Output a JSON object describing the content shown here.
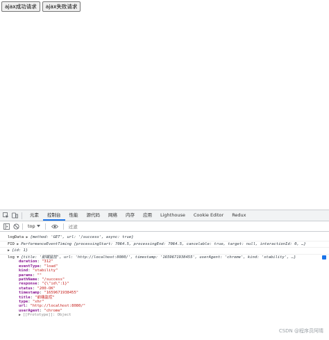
{
  "page": {
    "buttons": [
      "ajax成功请求",
      "ajax失败请求"
    ]
  },
  "devtools": {
    "tabs": [
      "元素",
      "控制台",
      "性能",
      "源代码",
      "网络",
      "内存",
      "应用",
      "Lighthouse",
      "Cookie Editor",
      "Redux"
    ],
    "active_tab": "控制台",
    "toolbar": {
      "context": "top",
      "filter_placeholder": "过滤"
    }
  },
  "console": {
    "line1": {
      "label": "logData",
      "text": "{method: 'GET', url: '/success', async: true}"
    },
    "line2": {
      "label": "FID",
      "type": "PerformanceEventTiming",
      "text": "{processingStart: 7064.5, processingEnd: 7064.5, cancelable: true, target: null, interactionId: 0, …}"
    },
    "line3": {
      "text": "{id: 1}"
    },
    "line4": {
      "label": "log",
      "text": "{title: '前端监控', url: 'http://localhost:8080/', timestamp: '1659671938455', userAgent: 'chrome', kind: 'stability', …}",
      "props": [
        {
          "key": "duration",
          "value": "\"312\""
        },
        {
          "key": "eventType",
          "value": "\"load\""
        },
        {
          "key": "kind",
          "value": "\"stability\""
        },
        {
          "key": "params",
          "value": "\"\""
        },
        {
          "key": "pathName",
          "value": "\"/success\""
        },
        {
          "key": "response",
          "value": "\"{\\\"id\\\":1}\""
        },
        {
          "key": "status",
          "value": "\"200-OK\""
        },
        {
          "key": "timestamp",
          "value": "\"1659671938455\""
        },
        {
          "key": "title",
          "value": "\"前端监控\""
        },
        {
          "key": "type",
          "value": "\"xhr\""
        },
        {
          "key": "url",
          "value": "\"http://localhost:8080/\""
        },
        {
          "key": "userAgent",
          "value": "\"chrome\""
        }
      ],
      "prototype": "[[Prototype]]: Object"
    }
  },
  "watermark": "CSDN @程序员阿晴"
}
